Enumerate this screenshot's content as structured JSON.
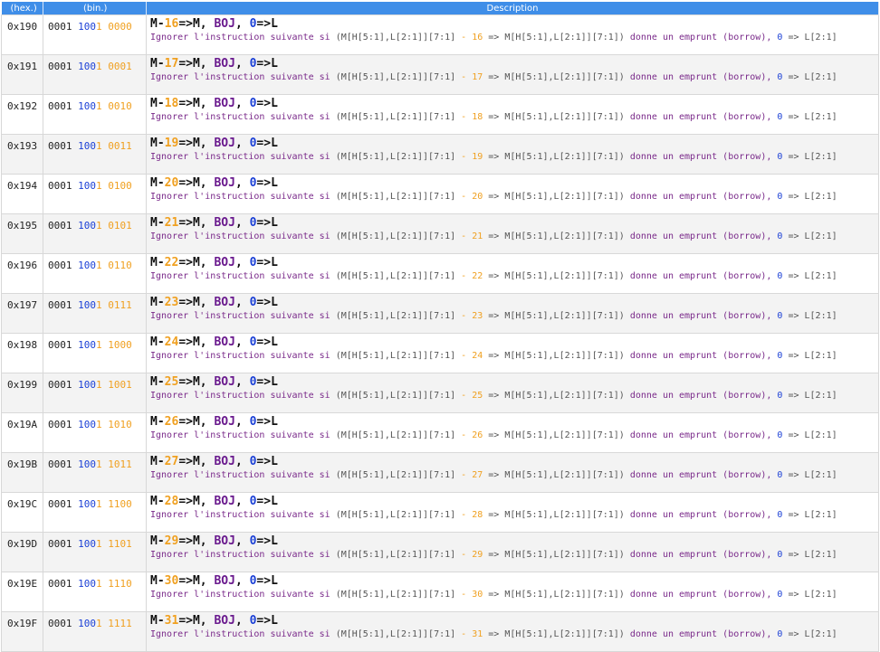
{
  "header": {
    "col_hex": "(hex.)",
    "col_bin": "(bin.)",
    "col_desc": "Description"
  },
  "text": {
    "mnemo_prefix": "M-",
    "mnemo_mid": "=>M, ",
    "mnemo_boj": "BOJ",
    "mnemo_sep": ", ",
    "mnemo_zero": "0",
    "mnemo_end": "=>L",
    "desc_start": "Ignorer l'instruction suivante si ",
    "desc_expr1": "(M[H[5:1],L[2:1]][7:1]",
    "desc_minus": " - ",
    "desc_arrow": " => ",
    "desc_expr2": "M[H[5:1],L[2:1]][7:1])",
    "desc_mid": " donne un emprunt (borrow), ",
    "desc_zero": "0",
    "desc_end": " => L[2:1]"
  },
  "rows": [
    {
      "hex": "0x190",
      "b1": "0001",
      "b2a": "100",
      "b2b": "1",
      "b3": "0000",
      "n": "16"
    },
    {
      "hex": "0x191",
      "b1": "0001",
      "b2a": "100",
      "b2b": "1",
      "b3": "0001",
      "n": "17"
    },
    {
      "hex": "0x192",
      "b1": "0001",
      "b2a": "100",
      "b2b": "1",
      "b3": "0010",
      "n": "18"
    },
    {
      "hex": "0x193",
      "b1": "0001",
      "b2a": "100",
      "b2b": "1",
      "b3": "0011",
      "n": "19"
    },
    {
      "hex": "0x194",
      "b1": "0001",
      "b2a": "100",
      "b2b": "1",
      "b3": "0100",
      "n": "20"
    },
    {
      "hex": "0x195",
      "b1": "0001",
      "b2a": "100",
      "b2b": "1",
      "b3": "0101",
      "n": "21"
    },
    {
      "hex": "0x196",
      "b1": "0001",
      "b2a": "100",
      "b2b": "1",
      "b3": "0110",
      "n": "22"
    },
    {
      "hex": "0x197",
      "b1": "0001",
      "b2a": "100",
      "b2b": "1",
      "b3": "0111",
      "n": "23"
    },
    {
      "hex": "0x198",
      "b1": "0001",
      "b2a": "100",
      "b2b": "1",
      "b3": "1000",
      "n": "24"
    },
    {
      "hex": "0x199",
      "b1": "0001",
      "b2a": "100",
      "b2b": "1",
      "b3": "1001",
      "n": "25"
    },
    {
      "hex": "0x19A",
      "b1": "0001",
      "b2a": "100",
      "b2b": "1",
      "b3": "1010",
      "n": "26"
    },
    {
      "hex": "0x19B",
      "b1": "0001",
      "b2a": "100",
      "b2b": "1",
      "b3": "1011",
      "n": "27"
    },
    {
      "hex": "0x19C",
      "b1": "0001",
      "b2a": "100",
      "b2b": "1",
      "b3": "1100",
      "n": "28"
    },
    {
      "hex": "0x19D",
      "b1": "0001",
      "b2a": "100",
      "b2b": "1",
      "b3": "1101",
      "n": "29"
    },
    {
      "hex": "0x19E",
      "b1": "0001",
      "b2a": "100",
      "b2b": "1",
      "b3": "1110",
      "n": "30"
    },
    {
      "hex": "0x19F",
      "b1": "0001",
      "b2a": "100",
      "b2b": "1",
      "b3": "1111",
      "n": "31"
    }
  ]
}
